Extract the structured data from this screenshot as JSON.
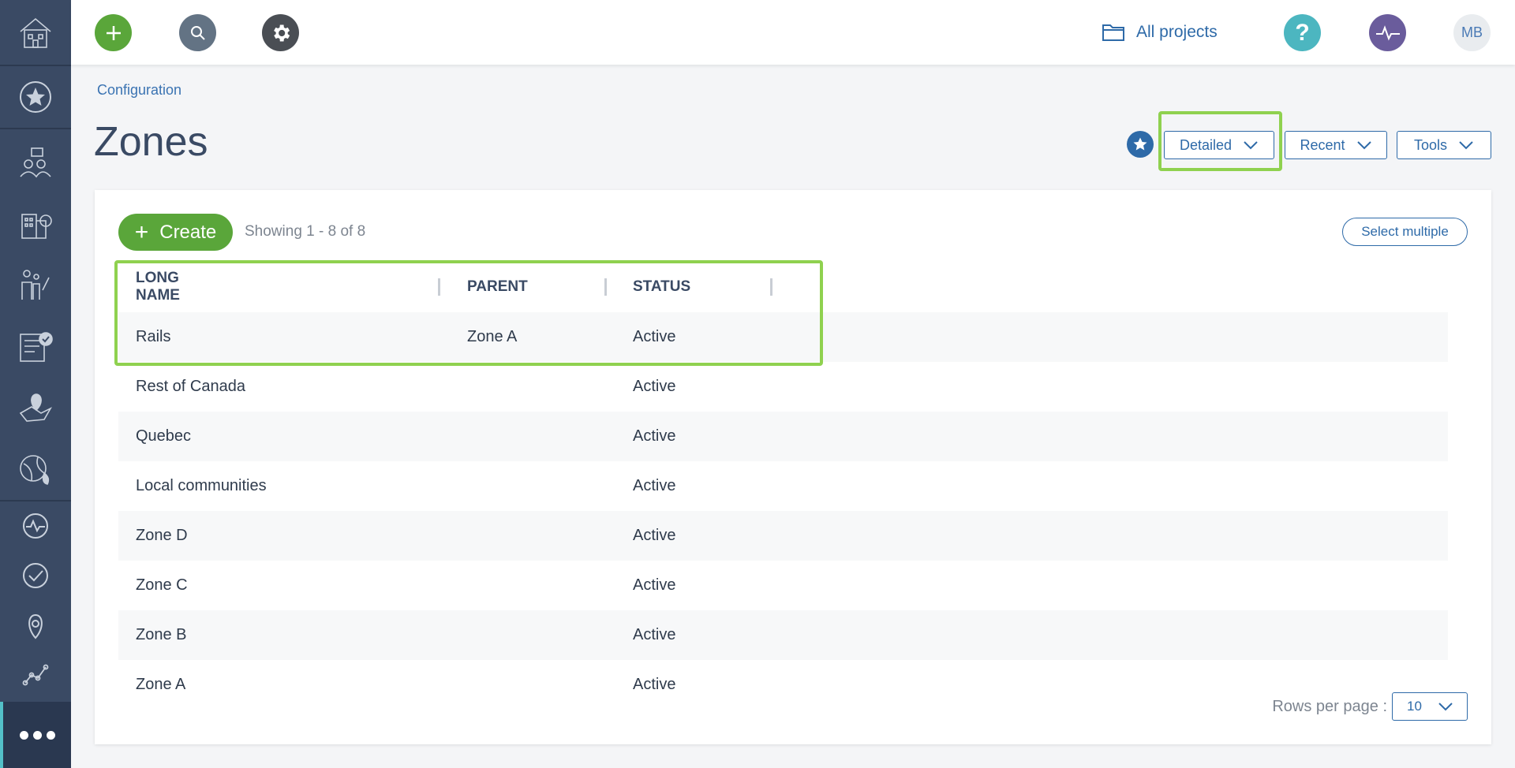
{
  "topbar": {
    "all_projects": "All projects",
    "avatar_initials": "MB"
  },
  "breadcrumb": "Configuration",
  "page_title": "Zones",
  "toolbar": {
    "detailed": "Detailed",
    "recent": "Recent",
    "tools": "Tools"
  },
  "card": {
    "create_label": "Create",
    "showing": "Showing 1 - 8 of 8",
    "select_multiple": "Select multiple",
    "rows_per_page_label": "Rows per page :",
    "rows_per_page_value": "10"
  },
  "table": {
    "headers": [
      "LONG NAME",
      "PARENT",
      "STATUS"
    ],
    "rows": [
      {
        "long_name": "Rails",
        "parent": "Zone A",
        "status": "Active"
      },
      {
        "long_name": "Rest of Canada",
        "parent": "",
        "status": "Active"
      },
      {
        "long_name": "Quebec",
        "parent": "",
        "status": "Active"
      },
      {
        "long_name": "Local communities",
        "parent": "",
        "status": "Active"
      },
      {
        "long_name": "Zone D",
        "parent": "",
        "status": "Active"
      },
      {
        "long_name": "Zone C",
        "parent": "",
        "status": "Active"
      },
      {
        "long_name": "Zone B",
        "parent": "",
        "status": "Active"
      },
      {
        "long_name": "Zone A",
        "parent": "",
        "status": "Active"
      }
    ]
  },
  "colors": {
    "sidebar": "#3a4a64",
    "accent_blue": "#2e6aa8",
    "create_green": "#5aa63a",
    "highlight_green": "#8fd14f",
    "help_teal": "#4cb6c0",
    "activity_purple": "#6a5c9c"
  }
}
